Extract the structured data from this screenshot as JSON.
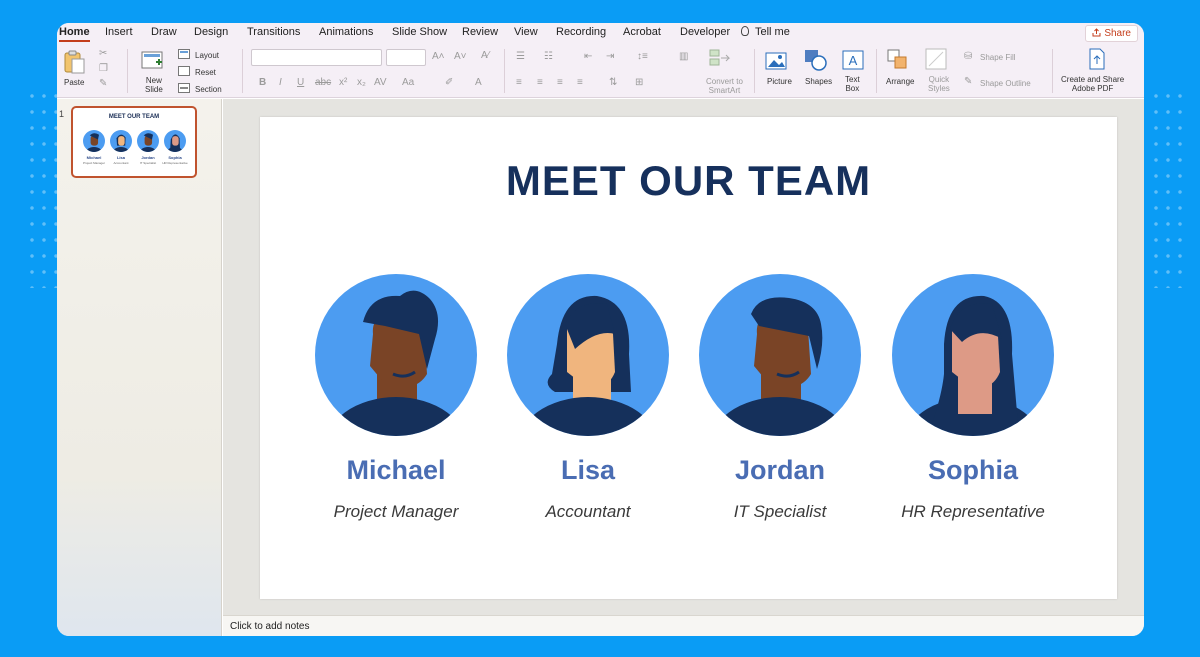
{
  "tabs": [
    {
      "label": "Home",
      "active": true
    },
    {
      "label": "Insert"
    },
    {
      "label": "Draw"
    },
    {
      "label": "Design"
    },
    {
      "label": "Transitions"
    },
    {
      "label": "Animations"
    },
    {
      "label": "Slide Show"
    },
    {
      "label": "Review"
    },
    {
      "label": "View"
    },
    {
      "label": "Recording"
    },
    {
      "label": "Acrobat"
    },
    {
      "label": "Developer"
    }
  ],
  "tell_me": "Tell me",
  "share_label": "Share",
  "ribbon": {
    "paste": "Paste",
    "new_slide": "New\nSlide",
    "layout": "Layout",
    "reset": "Reset",
    "section": "Section",
    "convert_smartart": "Convert to\nSmartArt",
    "picture": "Picture",
    "shapes": "Shapes",
    "text_box": "Text\nBox",
    "arrange": "Arrange",
    "quick_styles": "Quick\nStyles",
    "shape_fill": "Shape Fill",
    "shape_outline": "Shape Outline",
    "create_share_pdf": "Create and Share\nAdobe PDF"
  },
  "slide_number": "1",
  "slide": {
    "title": "MEET OUR TEAM",
    "members": [
      {
        "name": "Michael",
        "role": "Project Manager",
        "skin": "#7a4426",
        "hair": "#15305b",
        "style": "short"
      },
      {
        "name": "Lisa",
        "role": "Accountant",
        "skin": "#f0b57e",
        "hair": "#15305b",
        "style": "bob"
      },
      {
        "name": "Jordan",
        "role": "IT Specialist",
        "skin": "#7a4426",
        "hair": "#15305b",
        "style": "short"
      },
      {
        "name": "Sophia",
        "role": "HR Representative",
        "skin": "#dd9a86",
        "hair": "#15305b",
        "style": "long"
      }
    ]
  },
  "notes_placeholder": "Click to add notes",
  "colors": {
    "accent": "#c43e1c",
    "title": "#16305c",
    "name": "#4a6db3",
    "avatar_bg": "#4c9cf1"
  }
}
